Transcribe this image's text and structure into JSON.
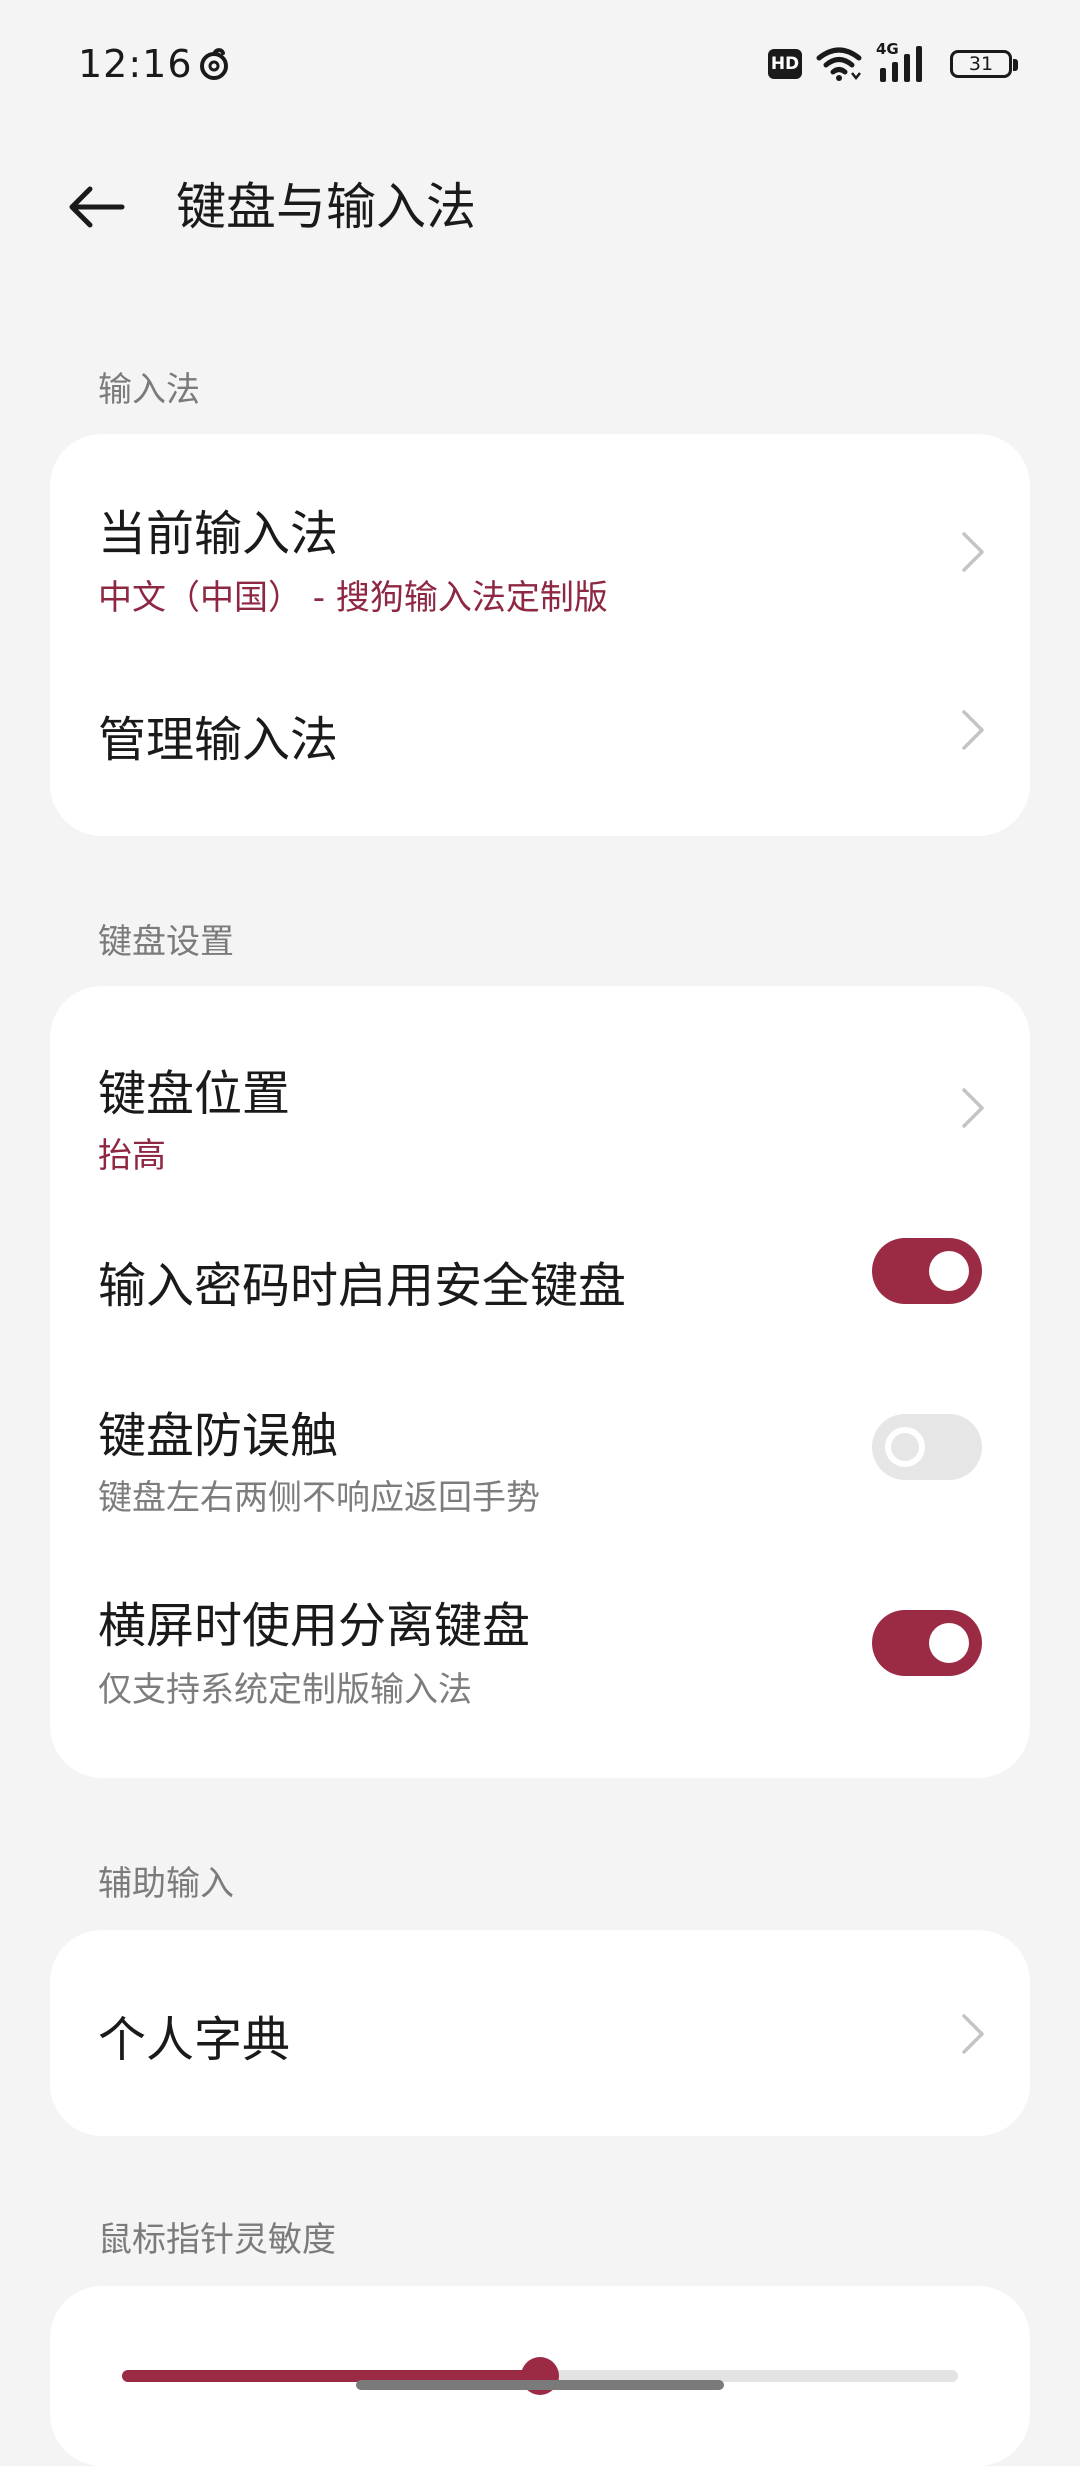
{
  "status_bar": {
    "time": "12:16",
    "notification_icon": "netease-music-icon",
    "hd_label": "HD",
    "network_label": "4G",
    "battery_level": "31"
  },
  "header": {
    "title": "键盘与输入法",
    "back_icon": "arrow-left-icon"
  },
  "sections": {
    "input_method": {
      "header": "输入法",
      "current_method": {
        "title": "当前输入法",
        "value": "中文（中国） - 搜狗输入法定制版"
      },
      "manage": {
        "title": "管理输入法"
      }
    },
    "keyboard_settings": {
      "header": "键盘设置",
      "position": {
        "title": "键盘位置",
        "value": "抬高"
      },
      "secure_keyboard": {
        "title": "输入密码时启用安全键盘",
        "enabled": true
      },
      "anti_mistouch": {
        "title": "键盘防误触",
        "subtitle": "键盘左右两侧不响应返回手势",
        "enabled": false
      },
      "split_keyboard": {
        "title": "横屏时使用分离键盘",
        "subtitle": "仅支持系统定制版输入法",
        "enabled": true
      }
    },
    "assist_input": {
      "header": "辅助输入",
      "personal_dictionary": {
        "title": "个人字典"
      }
    },
    "pointer_speed": {
      "header": "鼠标指针灵敏度",
      "value_fraction": 0.5
    }
  },
  "colors": {
    "accent": "#9b2a45",
    "accent_text": "#8e2742",
    "background": "#f4f4f4",
    "card": "#ffffff"
  }
}
